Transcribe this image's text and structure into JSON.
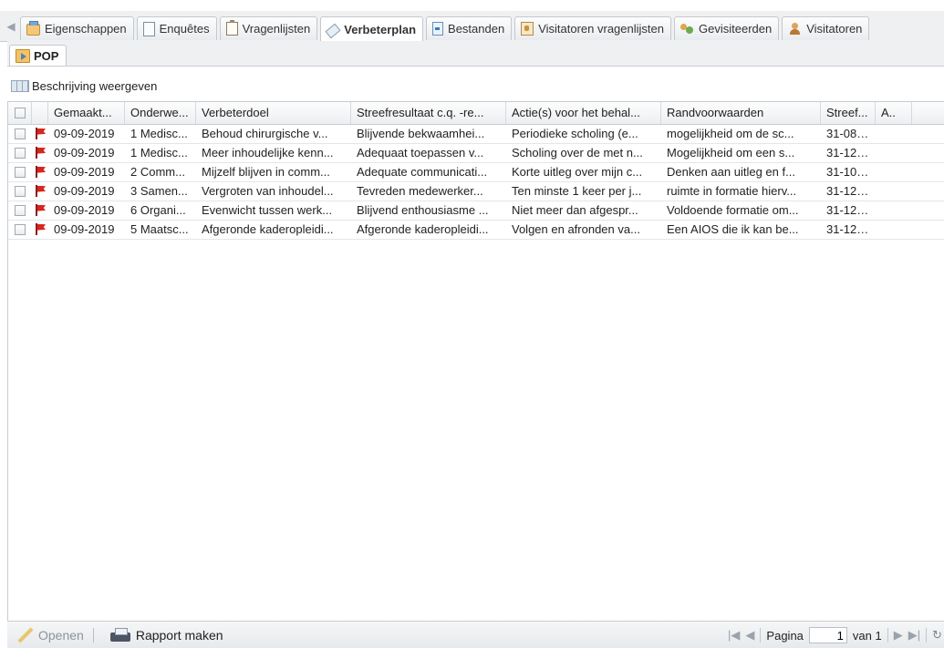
{
  "tabs": {
    "items": [
      {
        "label": "Eigenschappen",
        "icon": "properties-icon"
      },
      {
        "label": "Enquêtes",
        "icon": "document-icon"
      },
      {
        "label": "Vragenlijsten",
        "icon": "clipboard-icon"
      },
      {
        "label": "Verbeterplan",
        "icon": "tag-icon",
        "active": true
      },
      {
        "label": "Bestanden",
        "icon": "file-icon"
      },
      {
        "label": "Visitatoren vragenlijsten",
        "icon": "visitor-form-icon"
      },
      {
        "label": "Gevisiteerden",
        "icon": "people-icon"
      },
      {
        "label": "Visitatoren",
        "icon": "person-icon"
      }
    ]
  },
  "subtab": {
    "label": "POP"
  },
  "toolbar": {
    "description_label": "Beschrijving weergeven"
  },
  "grid": {
    "columns": [
      "Gemaakt op",
      "Onderwerp",
      "Verbeterdoel",
      "Streefresultaat c.q. -resultaat",
      "Actie(s) voor het behalen",
      "Randvoorwaarden",
      "Streefdatum",
      "A"
    ],
    "columns_display": [
      "Gemaakt...",
      "Onderwe...",
      "Verbeterdoel",
      "Streefresultaat c.q. -re...",
      "Actie(s) voor het behal...",
      "Randvoorwaarden",
      "Streef...",
      "A.."
    ],
    "rows": [
      {
        "date": "09-09-2019",
        "onderwerp": "1 Medisc...",
        "doel": "Behoud chirurgische v...",
        "streef": "Blijvende bekwaamhei...",
        "actie": "Periodieke scholing (e...",
        "rand": "mogelijkheid om de sc...",
        "sdatum": "31-08-..."
      },
      {
        "date": "09-09-2019",
        "onderwerp": "1 Medisc...",
        "doel": "Meer inhoudelijke kenn...",
        "streef": "Adequaat toepassen v...",
        "actie": "Scholing over de met n...",
        "rand": "Mogelijkheid om een s...",
        "sdatum": "31-12-..."
      },
      {
        "date": "09-09-2019",
        "onderwerp": "2 Comm...",
        "doel": "Mijzelf blijven in comm...",
        "streef": "Adequate communicati...",
        "actie": "Korte uitleg over mijn c...",
        "rand": "Denken aan uitleg en f...",
        "sdatum": "31-10-..."
      },
      {
        "date": "09-09-2019",
        "onderwerp": "3 Samen...",
        "doel": "Vergroten van inhoudel...",
        "streef": "Tevreden medewerker...",
        "actie": "Ten minste 1 keer per j...",
        "rand": "ruimte in formatie hierv...",
        "sdatum": "31-12-..."
      },
      {
        "date": "09-09-2019",
        "onderwerp": "6 Organi...",
        "doel": "Evenwicht tussen werk...",
        "streef": "Blijvend enthousiasme ...",
        "actie": "Niet meer dan afgespr...",
        "rand": "Voldoende formatie om...",
        "sdatum": "31-12-..."
      },
      {
        "date": "09-09-2019",
        "onderwerp": "5 Maatsc...",
        "doel": "Afgeronde kaderopleidi...",
        "streef": "Afgeronde kaderopleidi...",
        "actie": "Volgen en afronden va...",
        "rand": "Een AIOS die ik kan be...",
        "sdatum": "31-12-..."
      }
    ]
  },
  "bottom": {
    "open_label": "Openen",
    "report_label": "Rapport maken",
    "page_label": "Pagina",
    "page_value": "1",
    "of_label": "van 1"
  }
}
